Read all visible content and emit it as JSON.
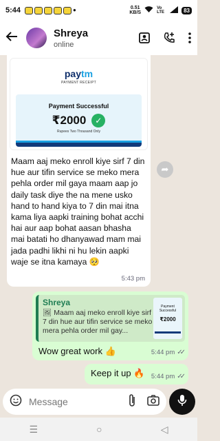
{
  "status_bar": {
    "time": "5:44",
    "speed_value": "0.51",
    "speed_unit": "KB/S",
    "network": "Vo LTE",
    "battery": "83"
  },
  "header": {
    "contact_name": "Shreya",
    "contact_status": "online",
    "icons": [
      "back-arrow-icon",
      "contact-card-icon",
      "add-call-icon",
      "more-vert-icon"
    ]
  },
  "receipt": {
    "brand": "paytm",
    "brand_a": "pay",
    "brand_b": "tm",
    "subtitle": "PAYMENT RECEIPT",
    "title": "Payment Successful",
    "amount": "₹2000",
    "amount_words": "Rupees Two Thousand Only"
  },
  "incoming_message": {
    "text": "Maam aaj meko enroll kiye sirf 7 din hue aur tifin service se meko mera pehla order mil gaya maam aap jo daily task diye the na mene usko hand to hand kiya to 7 din mai itna kama liya aapki training bohat acchi hai aur aap bohat aasan bhasha mai batati ho dhanyawad mam mai jada padhi likhi ni hu lekin aapki waje se itna kamaya 🥺",
    "time": "5:43 pm"
  },
  "reply_message": {
    "quoted_name": "Shreya",
    "quoted_text": "Maam aaj meko enroll kiye sirf 7 din hue aur tifin service se meko mera pehla order mil gay...",
    "thumb_title": "Payment Successful",
    "thumb_amount": "₹2000",
    "text": "Wow great work 👍",
    "time": "5:44 pm"
  },
  "short_message": {
    "text": "Keep it up 🔥",
    "time": "5:44 pm"
  },
  "composer": {
    "placeholder": "Message"
  },
  "colors": {
    "chat_bg": "#ece5dd",
    "outgoing_bubble": "#d9fdd3",
    "accent_green": "#1f7d53",
    "paytm_blue": "#0f2f6b"
  }
}
